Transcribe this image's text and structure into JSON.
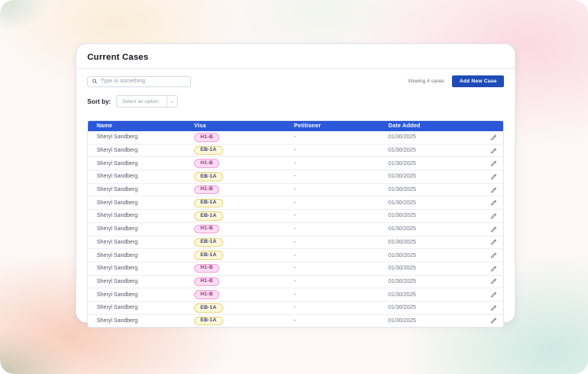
{
  "colors": {
    "header_blue": "#2b57d9",
    "button_blue": "#1e4bb8",
    "badge_pink_bg": "#fcdcf1",
    "badge_pink_border": "#f2a3d7",
    "badge_pink_text": "#8d3182",
    "badge_yellow_bg": "#fdf7dc",
    "badge_yellow_border": "#e9d67d",
    "badge_yellow_text": "#3c3f63"
  },
  "icons": {
    "search": "magnifier",
    "select_caret": "chevron-down",
    "row_edit": "pencil"
  },
  "card": {
    "title": "Current Cases",
    "search": {
      "placeholder": "Type in something"
    },
    "viewing_label": "Viewing 4 cases",
    "add_case_button": "Add New Case",
    "sort_by": {
      "label": "Sort by:",
      "selected": "Select an option",
      "caret": "⌄"
    },
    "table": {
      "columns": [
        "Name",
        "Visa",
        "Petitioner",
        "Date Added"
      ],
      "rows": [
        {
          "name": "Sheryl Sandberg",
          "visa": "H1-B",
          "petitioner": "-",
          "date_added": "01/30/2025"
        },
        {
          "name": "Sheryl Sandberg",
          "visa": "EB-1A",
          "petitioner": "-",
          "date_added": "01/30/2025"
        },
        {
          "name": "Sheryl Sandberg",
          "visa": "H1-B",
          "petitioner": "-",
          "date_added": "01/30/2025"
        },
        {
          "name": "Sheryl Sandberg",
          "visa": "EB-1A",
          "petitioner": "-",
          "date_added": "01/30/2025"
        },
        {
          "name": "Sheryl Sandberg",
          "visa": "H1-B",
          "petitioner": "-",
          "date_added": "01/30/2025"
        },
        {
          "name": "Sheryl Sandberg",
          "visa": "EB-1A",
          "petitioner": "-",
          "date_added": "01/30/2025"
        },
        {
          "name": "Sheryl Sandberg",
          "visa": "EB-1A",
          "petitioner": "-",
          "date_added": "01/30/2025"
        },
        {
          "name": "Sheryl Sandberg",
          "visa": "H1-B",
          "petitioner": "-",
          "date_added": "01/30/2025"
        },
        {
          "name": "Sheryl Sandberg",
          "visa": "EB-1A",
          "petitioner": "-",
          "date_added": "01/30/2025"
        },
        {
          "name": "Sheryl Sandberg",
          "visa": "EB-1A",
          "petitioner": "-",
          "date_added": "01/30/2025"
        },
        {
          "name": "Sheryl Sandberg",
          "visa": "H1-B",
          "petitioner": "-",
          "date_added": "01/30/2025"
        },
        {
          "name": "Sheryl Sandberg",
          "visa": "H1-B",
          "petitioner": "-",
          "date_added": "01/30/2025"
        },
        {
          "name": "Sheryl Sandberg",
          "visa": "H1-B",
          "petitioner": "-",
          "date_added": "01/30/2025"
        },
        {
          "name": "Sheryl Sandberg",
          "visa": "EB-1A",
          "petitioner": "-",
          "date_added": "01/30/2025"
        },
        {
          "name": "Sheryl Sandberg",
          "visa": "EB-1A",
          "petitioner": "-",
          "date_added": "01/30/2025"
        }
      ]
    }
  }
}
